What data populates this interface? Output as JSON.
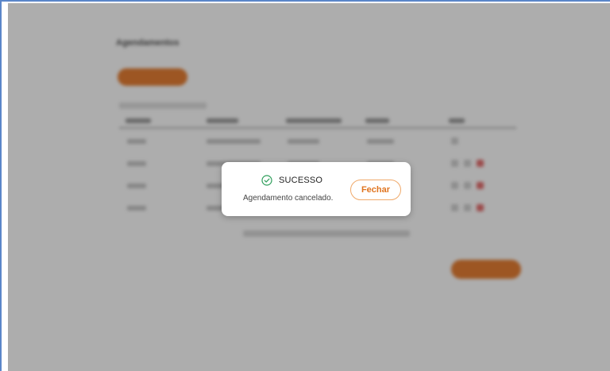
{
  "background": {
    "page_title": "Agendamentos",
    "accent_color": "#e36a12"
  },
  "modal": {
    "icon": "check-circle-icon",
    "icon_color": "#2e9e5b",
    "title": "SUCESSO",
    "message": "Agendamento cancelado.",
    "close_label": "Fechar",
    "close_color": "#e0741f"
  }
}
